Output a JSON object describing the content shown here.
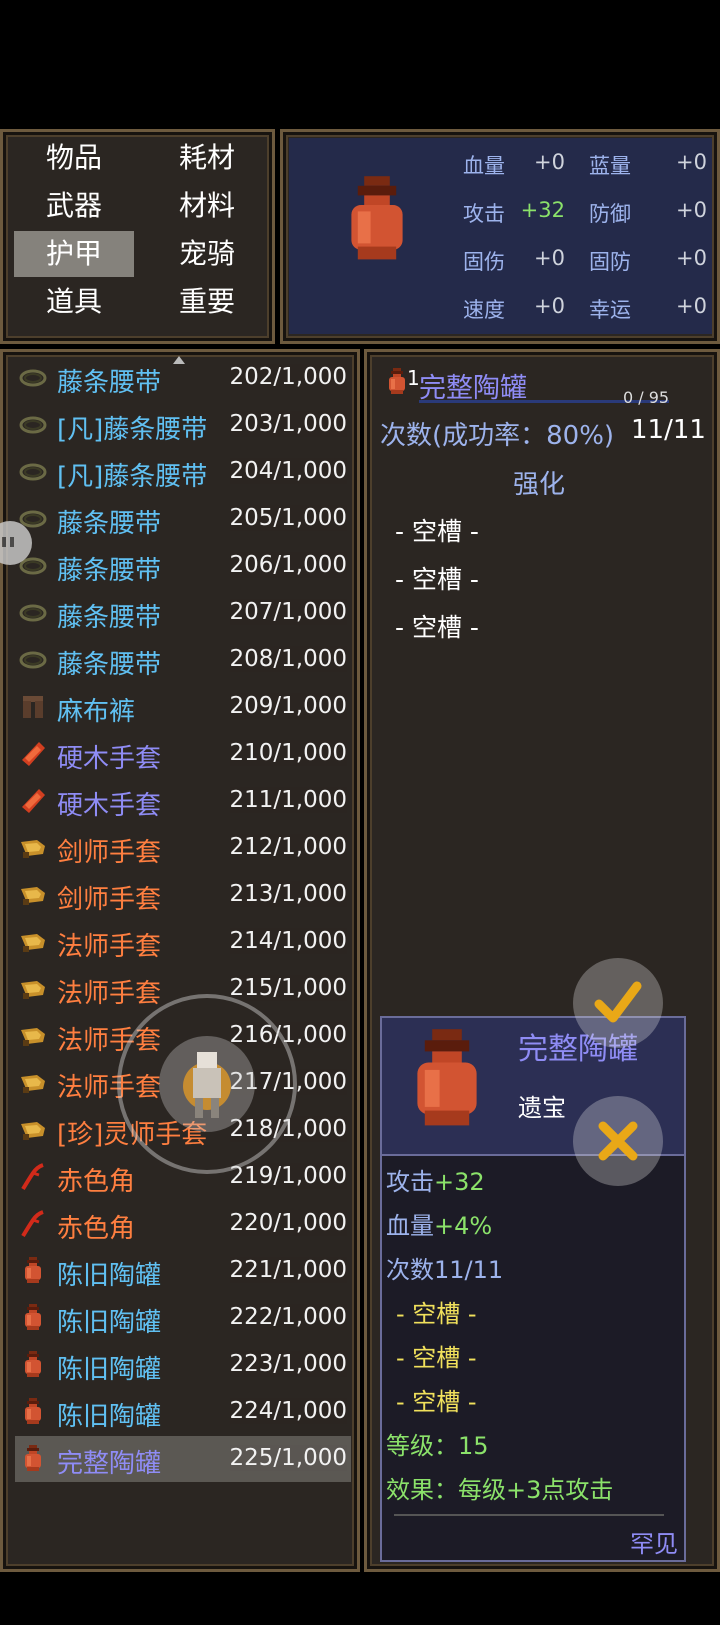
{
  "categories": [
    "物品",
    "耗材",
    "武器",
    "材料",
    "护甲",
    "宠骑",
    "道具",
    "重要"
  ],
  "selected_category": "护甲",
  "stats": [
    {
      "name": "血量",
      "value": "+0"
    },
    {
      "name": "蓝量",
      "value": "+0"
    },
    {
      "name": "攻击",
      "value": "+32"
    },
    {
      "name": "防御",
      "value": "+0"
    },
    {
      "name": "固伤",
      "value": "+0"
    },
    {
      "name": "固防",
      "value": "+0"
    },
    {
      "name": "速度",
      "value": "+0"
    },
    {
      "name": "幸运",
      "value": "+0"
    }
  ],
  "inventory": [
    {
      "name": "藤条腰带",
      "count": "202/1,000",
      "icon": "belt-icon",
      "color": "blue"
    },
    {
      "name": "[凡]藤条腰带",
      "count": "203/1,000",
      "icon": "belt-icon",
      "color": "blue"
    },
    {
      "name": "[凡]藤条腰带",
      "count": "204/1,000",
      "icon": "belt-icon",
      "color": "blue"
    },
    {
      "name": "藤条腰带",
      "count": "205/1,000",
      "icon": "belt-icon",
      "color": "blue"
    },
    {
      "name": "藤条腰带",
      "count": "206/1,000",
      "icon": "belt-icon",
      "color": "blue"
    },
    {
      "name": "藤条腰带",
      "count": "207/1,000",
      "icon": "belt-icon",
      "color": "blue"
    },
    {
      "name": "藤条腰带",
      "count": "208/1,000",
      "icon": "belt-icon",
      "color": "blue"
    },
    {
      "name": "麻布裤",
      "count": "209/1,000",
      "icon": "pants-icon",
      "color": "blue"
    },
    {
      "name": "硬木手套",
      "count": "210/1,000",
      "icon": "red-glove-icon",
      "color": "violet"
    },
    {
      "name": "硬木手套",
      "count": "211/1,000",
      "icon": "red-glove-icon",
      "color": "violet"
    },
    {
      "name": "剑师手套",
      "count": "212/1,000",
      "icon": "gold-glove-icon",
      "color": "orange"
    },
    {
      "name": "剑师手套",
      "count": "213/1,000",
      "icon": "gold-glove-icon",
      "color": "orange"
    },
    {
      "name": "法师手套",
      "count": "214/1,000",
      "icon": "gold-glove-icon",
      "color": "orange"
    },
    {
      "name": "法师手套",
      "count": "215/1,000",
      "icon": "gold-glove-icon",
      "color": "orange"
    },
    {
      "name": "法师手套",
      "count": "216/1,000",
      "icon": "gold-glove-icon",
      "color": "orange"
    },
    {
      "name": "法师手套",
      "count": "217/1,000",
      "icon": "gold-glove-icon",
      "color": "orange"
    },
    {
      "name": "[珍]灵师手套",
      "count": "218/1,000",
      "icon": "gold-glove-icon",
      "color": "orange"
    },
    {
      "name": "赤色角",
      "count": "219/1,000",
      "icon": "red-horn-icon",
      "color": "orange"
    },
    {
      "name": "赤色角",
      "count": "220/1,000",
      "icon": "red-horn-icon",
      "color": "orange"
    },
    {
      "name": "陈旧陶罐",
      "count": "221/1,000",
      "icon": "jar-icon",
      "color": "blue"
    },
    {
      "name": "陈旧陶罐",
      "count": "222/1,000",
      "icon": "jar-icon",
      "color": "blue"
    },
    {
      "name": "陈旧陶罐",
      "count": "223/1,000",
      "icon": "jar-icon",
      "color": "blue"
    },
    {
      "name": "陈旧陶罐",
      "count": "224/1,000",
      "icon": "jar-icon",
      "color": "blue"
    },
    {
      "name": "完整陶罐",
      "count": "225/1,000",
      "icon": "jar-icon",
      "color": "violet"
    }
  ],
  "detail": {
    "qty": "1",
    "name": "完整陶罐",
    "exp": "0 / 95",
    "attempts": "次数(成功率：80%)",
    "attempts_value": "11/11",
    "enhance": "强化",
    "slots": [
      "- 空槽 -",
      "- 空槽 -",
      "- 空槽 -"
    ]
  },
  "tooltip": {
    "name": "完整陶罐",
    "type": "遗宝",
    "lines": [
      {
        "label": "攻击",
        "value": "+32"
      },
      {
        "label": "血量",
        "value": "+4%"
      },
      {
        "label": "次数",
        "value": "11/11"
      }
    ],
    "slots": [
      "- 空槽 -",
      "- 空槽 -",
      "- 空槽 -"
    ],
    "level_label": "等级：",
    "level": "15",
    "effect_label": "效果：",
    "effect": "每级+3点攻击",
    "rarity": "罕见"
  },
  "colors": {
    "blue": "#60c0f2",
    "violet": "#8f8cf5",
    "orange": "#ff7f40",
    "green": "#8be26a",
    "yellow": "#f1e15c",
    "gold_check": "#e9a817"
  }
}
